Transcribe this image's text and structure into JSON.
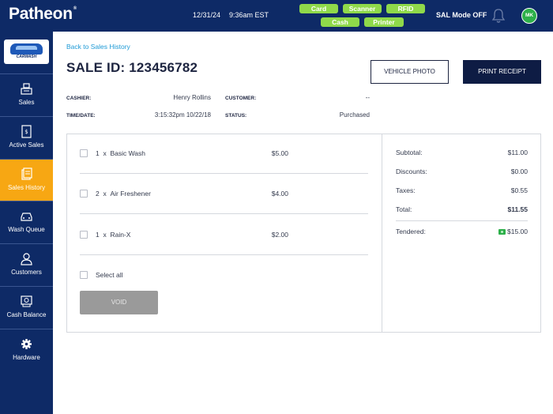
{
  "app": {
    "logo": "Patheon",
    "logo_mark": "®"
  },
  "header": {
    "date": "12/31/24",
    "time": "9:36am EST",
    "pills": [
      "Card",
      "Scanner",
      "RFID",
      "Cash",
      "Printer"
    ],
    "mode": "SAL Mode OFF",
    "avatar_initials": "MK",
    "pill_color": "#8fd94a"
  },
  "sidebar": {
    "brand": "CARWASH",
    "items": [
      {
        "label": "Sales",
        "icon": "register-icon"
      },
      {
        "label": "Active Sales",
        "icon": "receipt-icon"
      },
      {
        "label": "Sales History",
        "icon": "history-icon"
      },
      {
        "label": "Wash Queue",
        "icon": "car-icon"
      },
      {
        "label": "Customers",
        "icon": "user-icon"
      },
      {
        "label": "Cash Balance",
        "icon": "cash-register-icon"
      },
      {
        "label": "Hardware",
        "icon": "gear-icon"
      }
    ],
    "active_index": 2,
    "active_color": "#f7a713"
  },
  "main": {
    "back_link": "Back to Sales History",
    "sale_title": "SALE ID: 123456782",
    "vehicle_photo_label": "VEHICLE PHOTO",
    "print_receipt_label": "PRINT RECEIPT",
    "meta": {
      "cashier_label": "CASHIER:",
      "cashier_value": "Henry Rollins",
      "customer_label": "CUSTOMER:",
      "customer_value": "--",
      "time_label": "TIME/DATE:",
      "time_value": "3:15:32pm  10/22/18",
      "status_label": "STATUS:",
      "status_value": "Purchased"
    },
    "items": [
      {
        "qty": "1",
        "x": "x",
        "name": "Basic Wash",
        "price": "$5.00"
      },
      {
        "qty": "2",
        "x": "x",
        "name": "Air Freshener",
        "price": "$4.00"
      },
      {
        "qty": "1",
        "x": "x",
        "name": "Rain-X",
        "price": "$2.00"
      }
    ],
    "select_all_label": "Select all",
    "void_label": "VOID",
    "summary": {
      "subtotal_label": "Subtotal:",
      "subtotal_value": "$11.00",
      "discounts_label": "Discounts:",
      "discounts_value": "$0.00",
      "taxes_label": "Taxes:",
      "taxes_value": "$0.55",
      "total_label": "Total:",
      "total_value": "$11.55",
      "tendered_label": "Tendered:",
      "tendered_value": "$15.00",
      "tendered_icon": "cash-icon"
    }
  }
}
